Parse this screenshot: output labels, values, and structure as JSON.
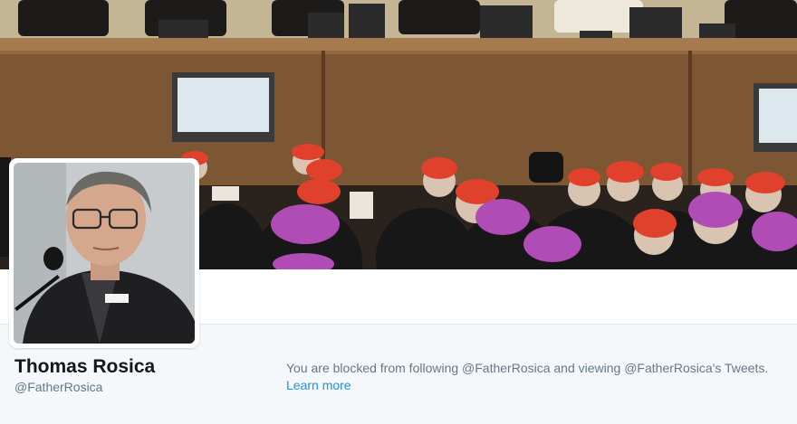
{
  "profile": {
    "name": "Thomas Rosica",
    "handle": "@FatherRosica"
  },
  "blocked_notice": {
    "message": "You are blocked from following @FatherRosica and viewing @FatherRosica's Tweets.",
    "learn_more_label": "Learn more"
  },
  "colors": {
    "link": "#1b95e0",
    "name_text": "#14171a",
    "secondary_text": "#657786",
    "page_background": "#f5f8fa"
  }
}
